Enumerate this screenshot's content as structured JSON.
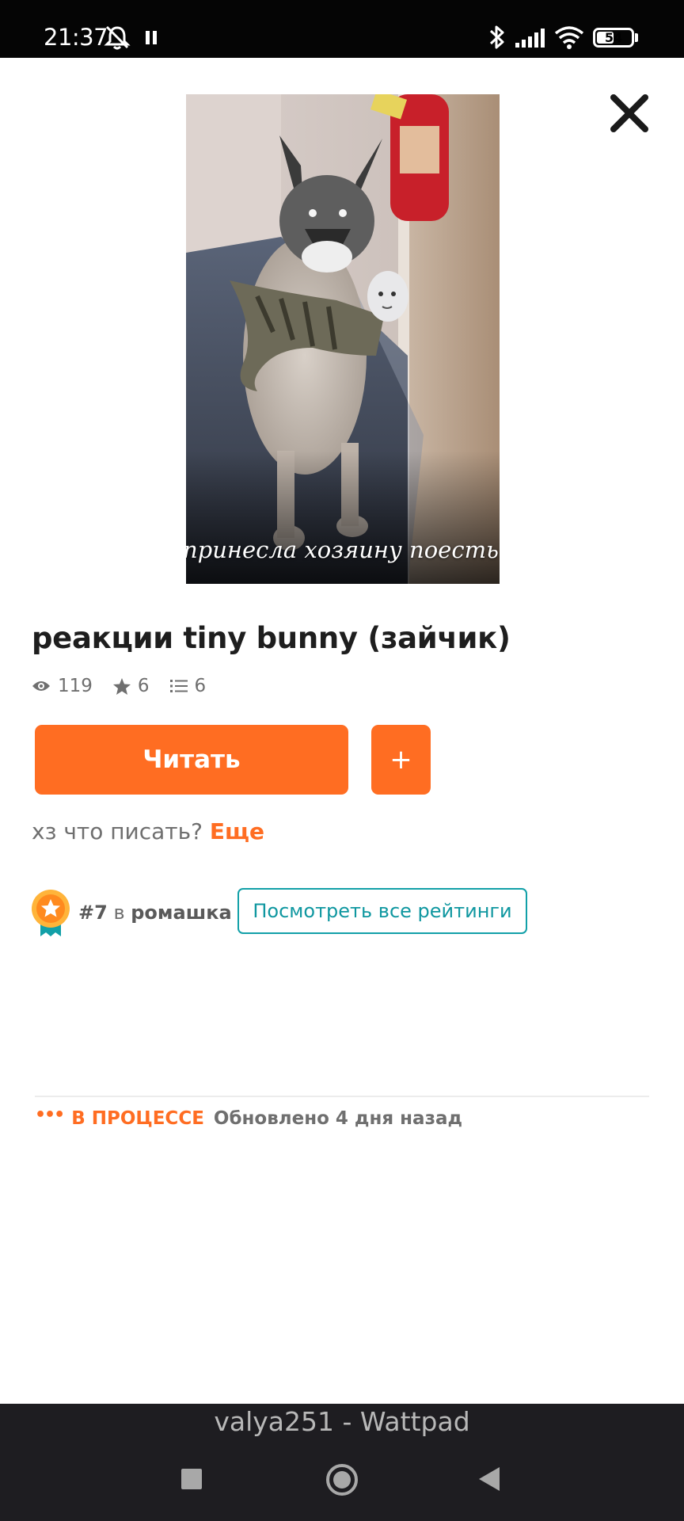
{
  "status_bar": {
    "time": "21:37",
    "battery": "54",
    "battery_level": 0.54,
    "icons": [
      "bell-off-icon",
      "pause-icon",
      "bluetooth-icon",
      "signal-icon",
      "wifi-icon",
      "battery-icon"
    ]
  },
  "cover": {
    "caption": "принесла хозяину поесть",
    "image_description": "edited photo of a fluffy cat-like creature with a wolf head holding a tabby cat with a small face, in a hallway next to a red fire extinguisher"
  },
  "story": {
    "title": "реакции tiny bunny (зайчик)",
    "stats": {
      "views": "119",
      "votes": "6",
      "parts": "6"
    },
    "read_label": "Читать",
    "add_label": "+",
    "description": "хз что писать? ",
    "more_label": "Еще"
  },
  "ranking": {
    "rank": "#7",
    "preposition": " в ",
    "tag": "ромашка",
    "view_all_label": "Посмотреть все рейтинги"
  },
  "progress": {
    "dots": "•••",
    "status": "В ПРОЦЕССЕ",
    "updated": "Обновлено 4 дня назад"
  },
  "app_label": "valya251 - Wattpad",
  "colors": {
    "accent": "#ff6d22",
    "teal": "#12a0a8",
    "status_bar": "#050505",
    "nav_bar": "#1e1d21"
  }
}
